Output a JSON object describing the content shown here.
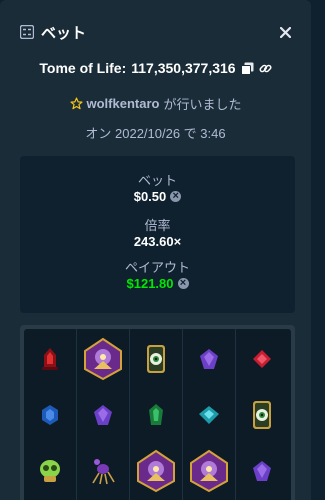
{
  "header": {
    "title": "ベット"
  },
  "game": {
    "name": "Tome of Life",
    "separator": ":",
    "id": "117,350,377,316"
  },
  "user": {
    "name": "wolfkentaro",
    "suffix": "が行いました"
  },
  "date_text": "オン 2022/10/26 で 3:46",
  "stats": {
    "bet_label": "ベット",
    "bet_value": "$0.50",
    "multiplier_label": "倍率",
    "multiplier_value": "243.60×",
    "payout_label": "ペイアウト",
    "payout_value": "$121.80"
  },
  "colors": {
    "accent_green": "#00e701",
    "bg": "#1a2c38",
    "panel": "#0f212e"
  },
  "board": {
    "rows": [
      [
        "red-lantern",
        "wizard-king",
        "golden-eye",
        "purple-gem",
        "red-gem"
      ],
      [
        "blue-gem",
        "purple-gem",
        "green-gem",
        "cyan-gem",
        "golden-eye"
      ],
      [
        "green-skull",
        "purple-spider",
        "wizard-king",
        "wizard-king",
        "purple-gem"
      ]
    ]
  }
}
